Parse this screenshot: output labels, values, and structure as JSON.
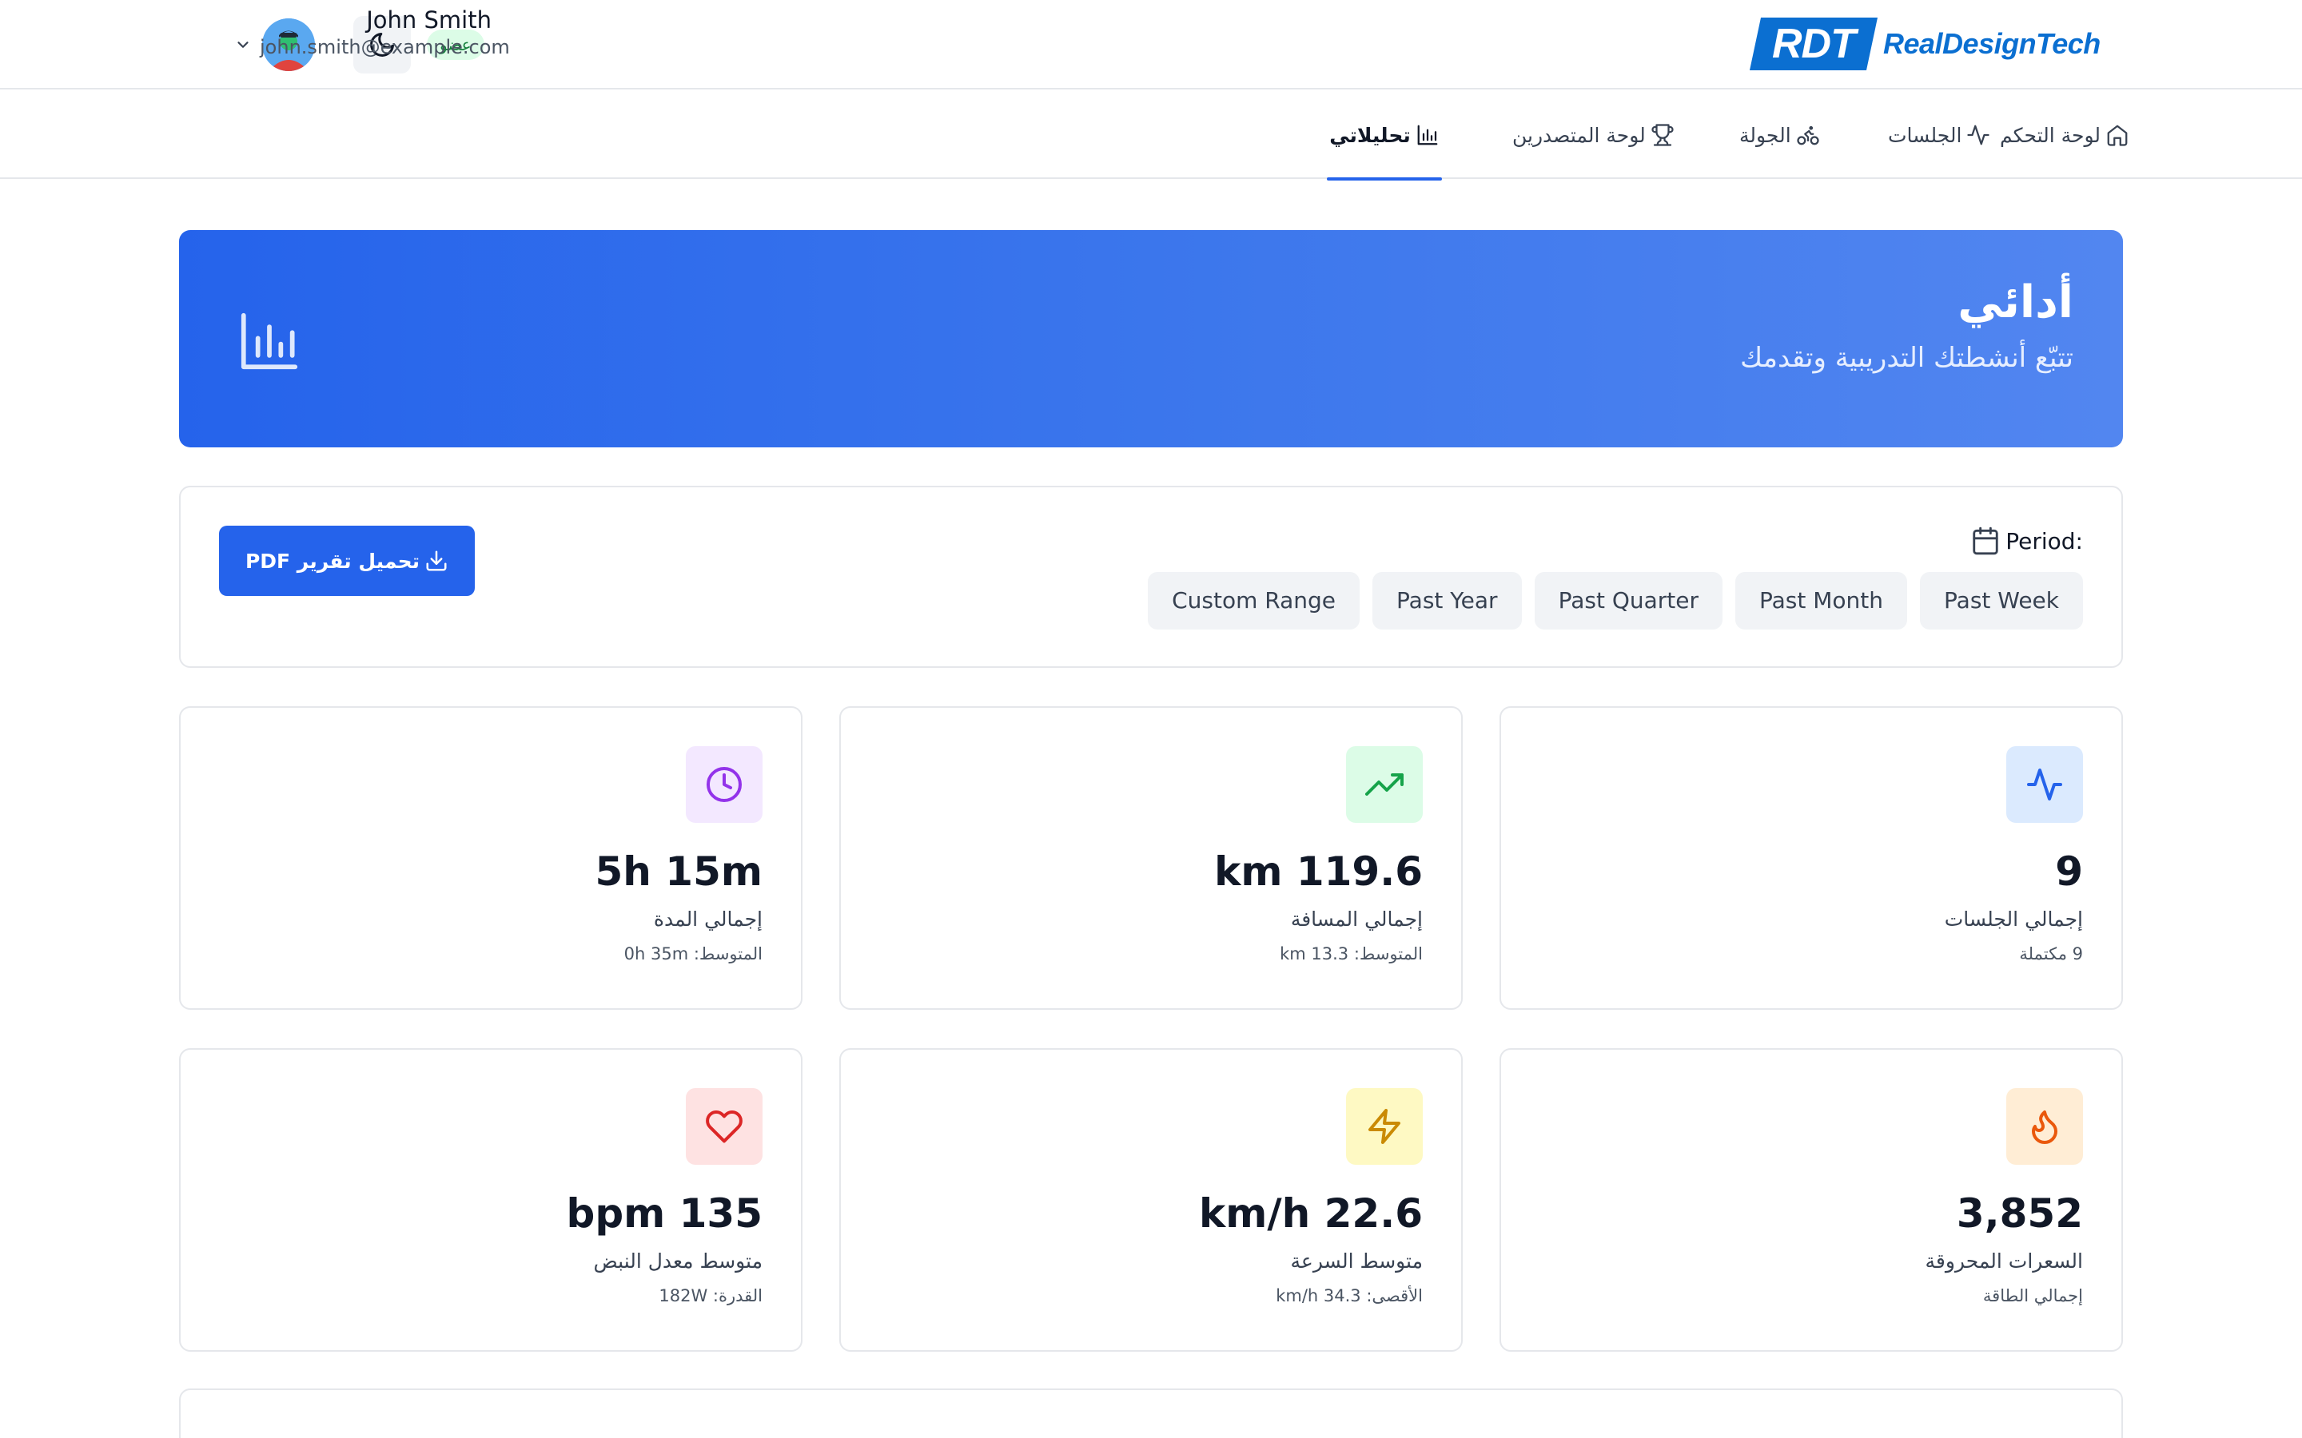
{
  "header": {
    "logo_mark": "RDT",
    "logo_text": "RealDesignTech",
    "user_name": "John Smith",
    "user_email": "john.smith@example.com",
    "role_badge": "عضو"
  },
  "nav": {
    "tabs": [
      {
        "label": "لوحة التحكم",
        "icon": "home-icon"
      },
      {
        "label": "الجلسات",
        "icon": "activity-icon"
      },
      {
        "label": "الجولة",
        "icon": "bike-icon"
      },
      {
        "label": "لوحة المتصدرين",
        "icon": "trophy-icon"
      },
      {
        "label": "تحليلاتي",
        "icon": "bar-chart-icon",
        "active": true
      }
    ]
  },
  "hero": {
    "title": "أدائي",
    "subtitle": "تتبّع أنشطتك التدريبية وتقدمك",
    "color_start": "#2563eb",
    "color_end": "#5286f0"
  },
  "filter": {
    "period_label": "Period:",
    "periods": [
      "Past Week",
      "Past Month",
      "Past Quarter",
      "Past Year",
      "Custom Range"
    ],
    "download_label": "تحميل تقرير PDF"
  },
  "stats": [
    {
      "value": "9",
      "label": "إجمالي الجلسات",
      "sub": "9 مكتملة",
      "icon": "activity-icon",
      "icon_color": "#2563eb",
      "bg": "#dbeafe"
    },
    {
      "value": "km 119.6",
      "label": "إجمالي المسافة",
      "sub": "المتوسط: km 13.3",
      "icon": "trending-up-icon",
      "icon_color": "#16a34a",
      "bg": "#dcfce7"
    },
    {
      "value": "5h 15m",
      "label": "إجمالي المدة",
      "sub": "المتوسط: 0h 35m",
      "icon": "clock-icon",
      "icon_color": "#9333ea",
      "bg": "#f3e8ff"
    },
    {
      "value": "3,852",
      "label": "السعرات المحروقة",
      "sub": "إجمالي الطاقة",
      "icon": "flame-icon",
      "icon_color": "#ea580c",
      "bg": "#ffedd5"
    },
    {
      "value": "km/h 22.6",
      "label": "متوسط السرعة",
      "sub": "الأقصى: km/h 34.3",
      "icon": "zap-icon",
      "icon_color": "#ca8a04",
      "bg": "#fef9c3"
    },
    {
      "value": "bpm 135",
      "label": "متوسط معدل النبض",
      "sub": "القدرة: 182W",
      "icon": "heart-icon",
      "icon_color": "#dc2626",
      "bg": "#fee2e2"
    }
  ],
  "colors": {
    "accent": "#2563eb",
    "brand": "#0b6fd1",
    "border": "#e5e7eb"
  }
}
